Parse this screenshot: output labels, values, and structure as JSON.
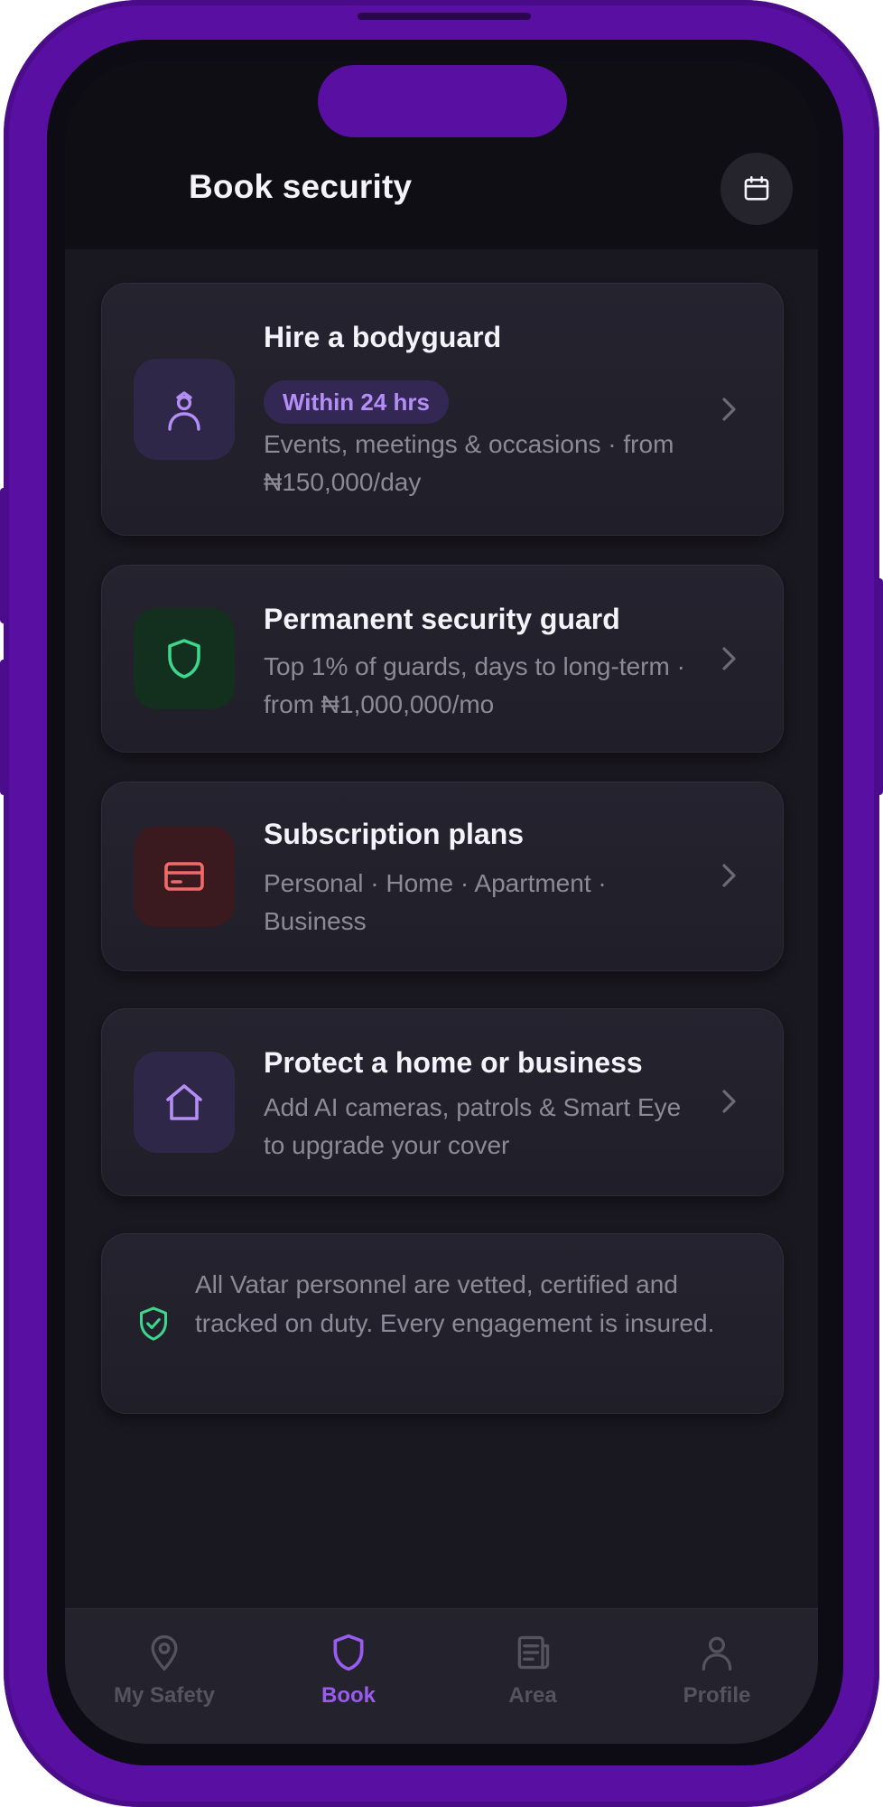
{
  "header": {
    "title": "Book security",
    "calendar_icon": "calendar-icon"
  },
  "cards": [
    {
      "title": "Hire a bodyguard",
      "badge": "Within 24 hrs",
      "subtitle": "Events, meetings & occasions · from ₦150,000/day",
      "icon": "bodyguard-icon",
      "icon_bg": "#2f2748",
      "icon_color": "#b48df5"
    },
    {
      "title": "Permanent security guard",
      "subtitle": "Top 1% of guards, days to long-term · from ₦1,000,000/mo",
      "icon": "shield-icon",
      "icon_bg": "#13301f",
      "icon_color": "#3dd68c"
    },
    {
      "title": "Subscription plans",
      "subtitle": "Personal · Home · Apartment · Business",
      "icon": "card-icon",
      "icon_bg": "#3a1a1f",
      "icon_color": "#f06a6a"
    },
    {
      "title": "Protect a home or business",
      "subtitle": "Add AI cameras, patrols & Smart Eye to upgrade your cover",
      "icon": "home-icon",
      "icon_bg": "#2f2748",
      "icon_color": "#b48df5"
    }
  ],
  "notice": {
    "text": "All Vatar personnel are vetted, certified and tracked on duty. Every engagement is insured.",
    "icon": "shield-check-icon",
    "icon_color": "#3dd68c"
  },
  "tabbar": {
    "active": "Book",
    "accent": "#9a5cf0",
    "items": [
      {
        "label": "My Safety",
        "icon": "location-pin-icon"
      },
      {
        "label": "Book",
        "icon": "shield-icon"
      },
      {
        "label": "Area",
        "icon": "newspaper-icon"
      },
      {
        "label": "Profile",
        "icon": "person-icon"
      }
    ]
  },
  "colors": {
    "frame": "#5a0fa3",
    "screen_bg": "#19171f",
    "card_bg": "#23212c"
  }
}
